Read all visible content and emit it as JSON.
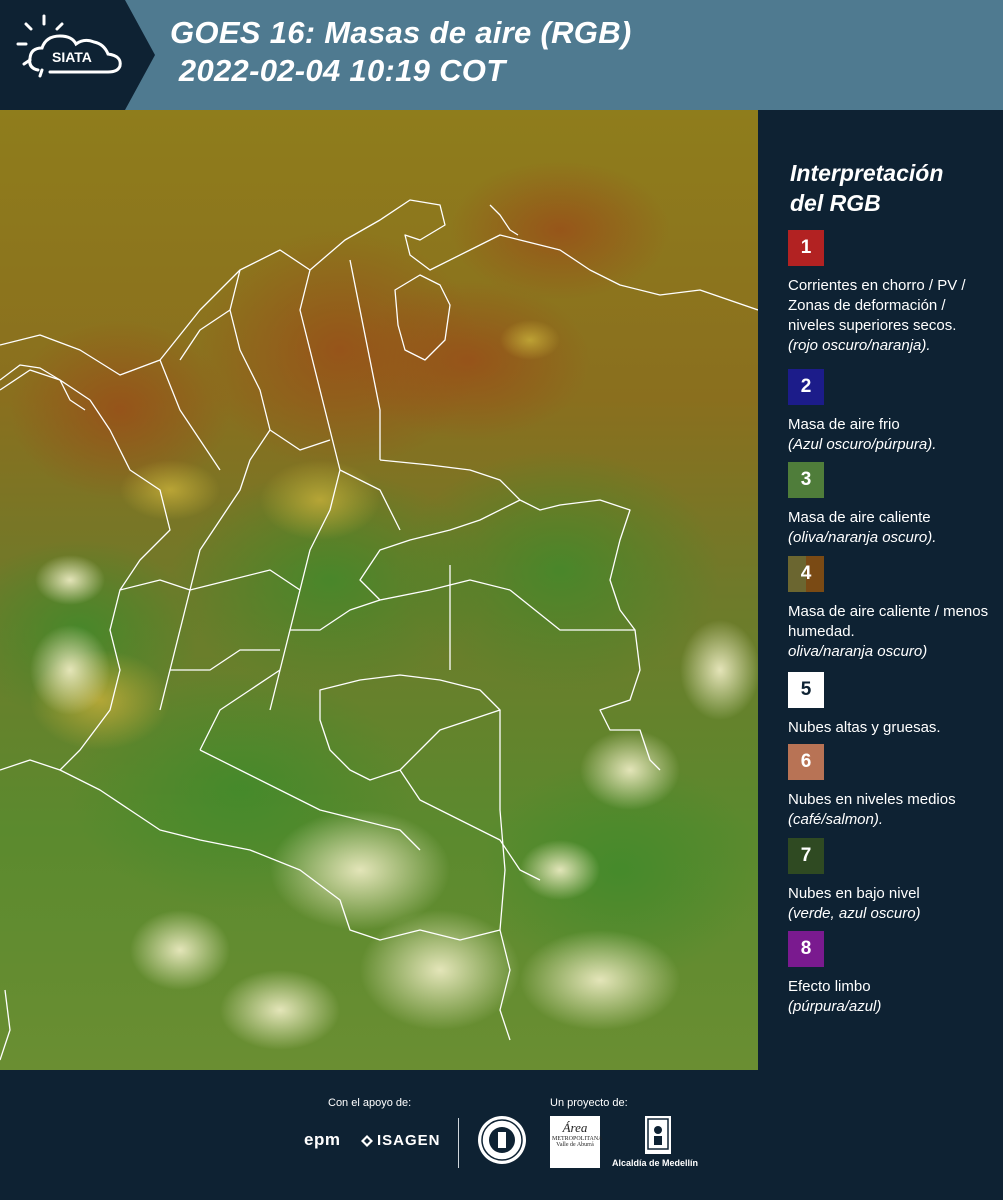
{
  "header": {
    "logo_text": "SIATA",
    "title_line1": "GOES 16: Masas de aire (RGB)",
    "title_line2": " 2022-02-04 10:19 COT",
    "bg_color": "#4f7a90",
    "logo_bg_color": "#0e2233"
  },
  "legend": {
    "title_line1": "Interpretación",
    "title_line2": "del RGB",
    "items": [
      {
        "number": "1",
        "color": "#b22222",
        "text": "Corrientes en chorro / PV / Zonas de deformación / niveles superiores secos.",
        "sub": "(rojo oscuro/naranja)."
      },
      {
        "number": "2",
        "color": "#1c1c8a",
        "text": "Masa de aire frio",
        "sub": "(Azul oscuro/púrpura)."
      },
      {
        "number": "3",
        "color": "#4f7d3a",
        "text": "Masa de aire caliente",
        "sub": "(oliva/naranja oscuro)."
      },
      {
        "number": "4",
        "color": "#6b6630",
        "color2": "#7a4a14",
        "text": "Masa de aire caliente / menos humedad.",
        "sub": "oliva/naranja oscuro)"
      },
      {
        "number": "5",
        "color": "#ffffff",
        "text": "Nubes altas y gruesas.",
        "sub": ""
      },
      {
        "number": "6",
        "color": "#b87355",
        "text": "Nubes en niveles medios",
        "sub": "(café/salmon)."
      },
      {
        "number": "7",
        "color": "#2f4a22",
        "text": "Nubes en bajo nivel",
        "sub": "(verde, azul oscuro)"
      },
      {
        "number": "8",
        "color": "#7a1a8f",
        "text": "Efecto limbo",
        "sub": "(púrpura/azul)"
      }
    ]
  },
  "footer": {
    "support_label": "Con el apoyo de:",
    "project_label": "Un proyecto de:",
    "epm": "epm",
    "isagen": "ISAGEN",
    "area_name": "Área",
    "area_sub": "METROPOLITANA",
    "area_sub2": "Valle de Aburrá",
    "alcaldia": "Alcaldía de Medellín"
  }
}
